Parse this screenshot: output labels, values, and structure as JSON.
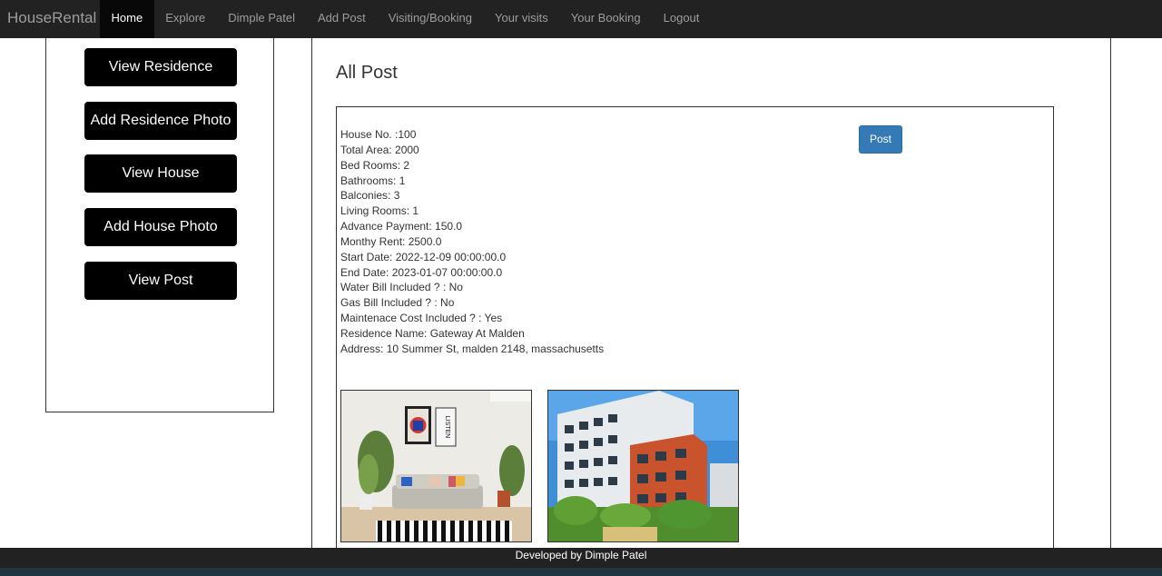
{
  "navbar": {
    "brand": "HouseRental",
    "items": [
      {
        "label": "Home",
        "active": true
      },
      {
        "label": "Explore"
      },
      {
        "label": "Dimple Patel"
      },
      {
        "label": "Add Post"
      },
      {
        "label": "Visiting/Booking"
      },
      {
        "label": "Your visits"
      },
      {
        "label": "Your Booking"
      },
      {
        "label": "Logout"
      }
    ]
  },
  "sidebar": {
    "buttons": [
      {
        "label": "View Residence"
      },
      {
        "label": "Add Residence Photo"
      },
      {
        "label": "View House"
      },
      {
        "label": "Add House Photo"
      },
      {
        "label": "View Post"
      }
    ]
  },
  "main": {
    "title": "All Post",
    "post": {
      "button_label": "Post",
      "details": [
        "House No. :100",
        "Total Area: 2000",
        "Bed Rooms: 2",
        "Bathrooms: 1",
        "Balconies: 3",
        "Living Rooms: 1",
        "Advance Payment: 150.0",
        "Monthy Rent: 2500.0",
        "Start Date: 2022-12-09 00:00:00.0",
        "End Date: 2023-01-07 00:00:00.0",
        "Water Bill Included ? : No",
        "Gas Bill Included ? : No",
        "Maintenace Cost Included ? : Yes",
        "Residence Name: Gateway At Malden",
        "Address: 10 Summer St, malden 2148, massachusetts"
      ],
      "photos": [
        {
          "icon": "living-room-photo"
        },
        {
          "icon": "apartment-building-photo",
          "sign_text": "LISTEN"
        }
      ]
    }
  },
  "footer": {
    "text": "Developed by Dimple Patel"
  },
  "colors": {
    "navbar": "#222222",
    "primary": "#337ab7",
    "sidebar_button": "#000000"
  }
}
